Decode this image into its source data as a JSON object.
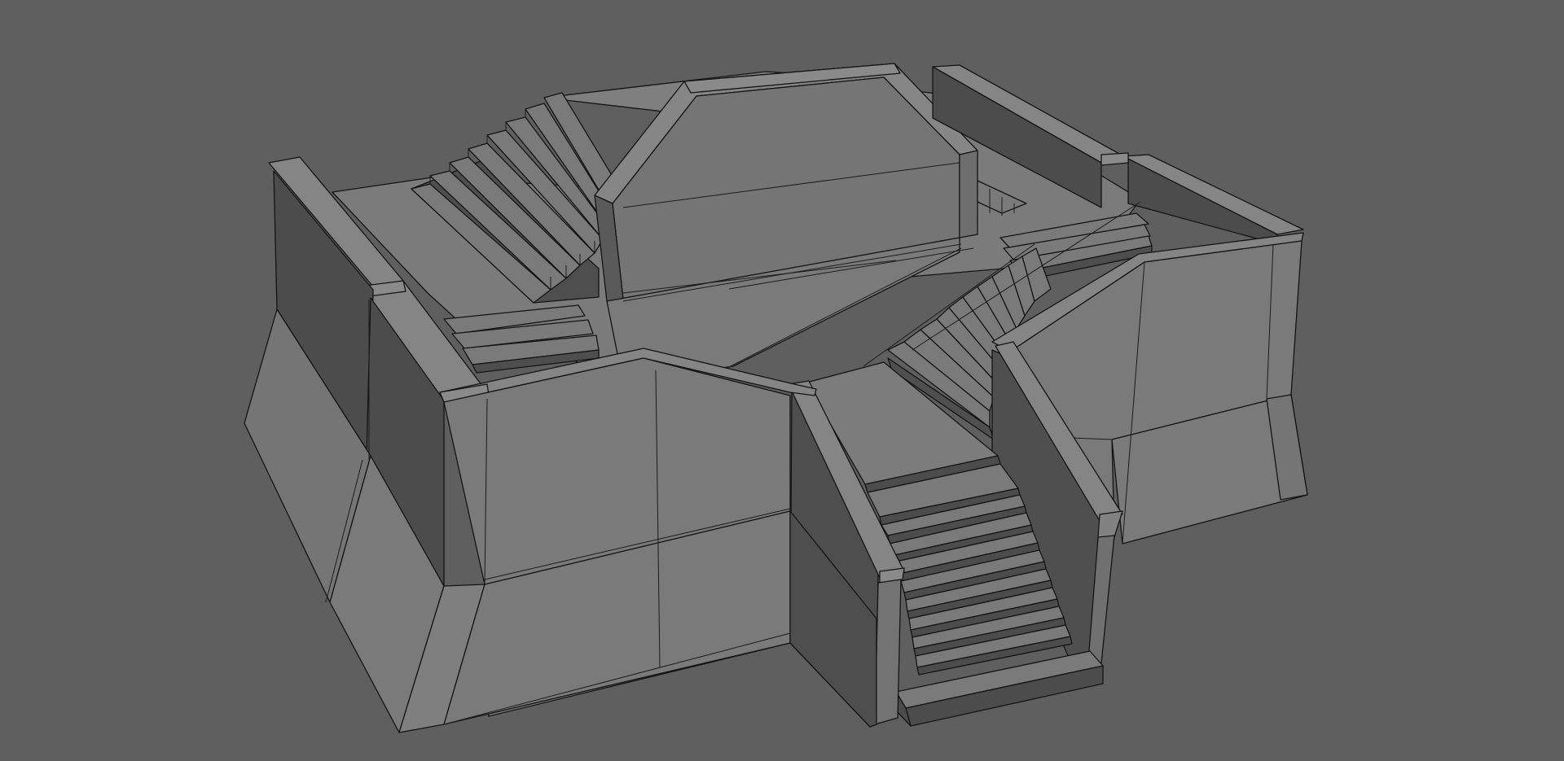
{
  "viewport": {
    "background_color": "#5f5f5f",
    "render_mode": "shaded-wireframe",
    "subject": "3d-model-stepped-plaza"
  },
  "materials": {
    "top_face": "#7f7f7f",
    "front_face": "#737373",
    "side_face": "#505050",
    "step_tread": "#7a7a7a",
    "step_riser": "#4c4c4c",
    "edge_line": "#141414"
  }
}
